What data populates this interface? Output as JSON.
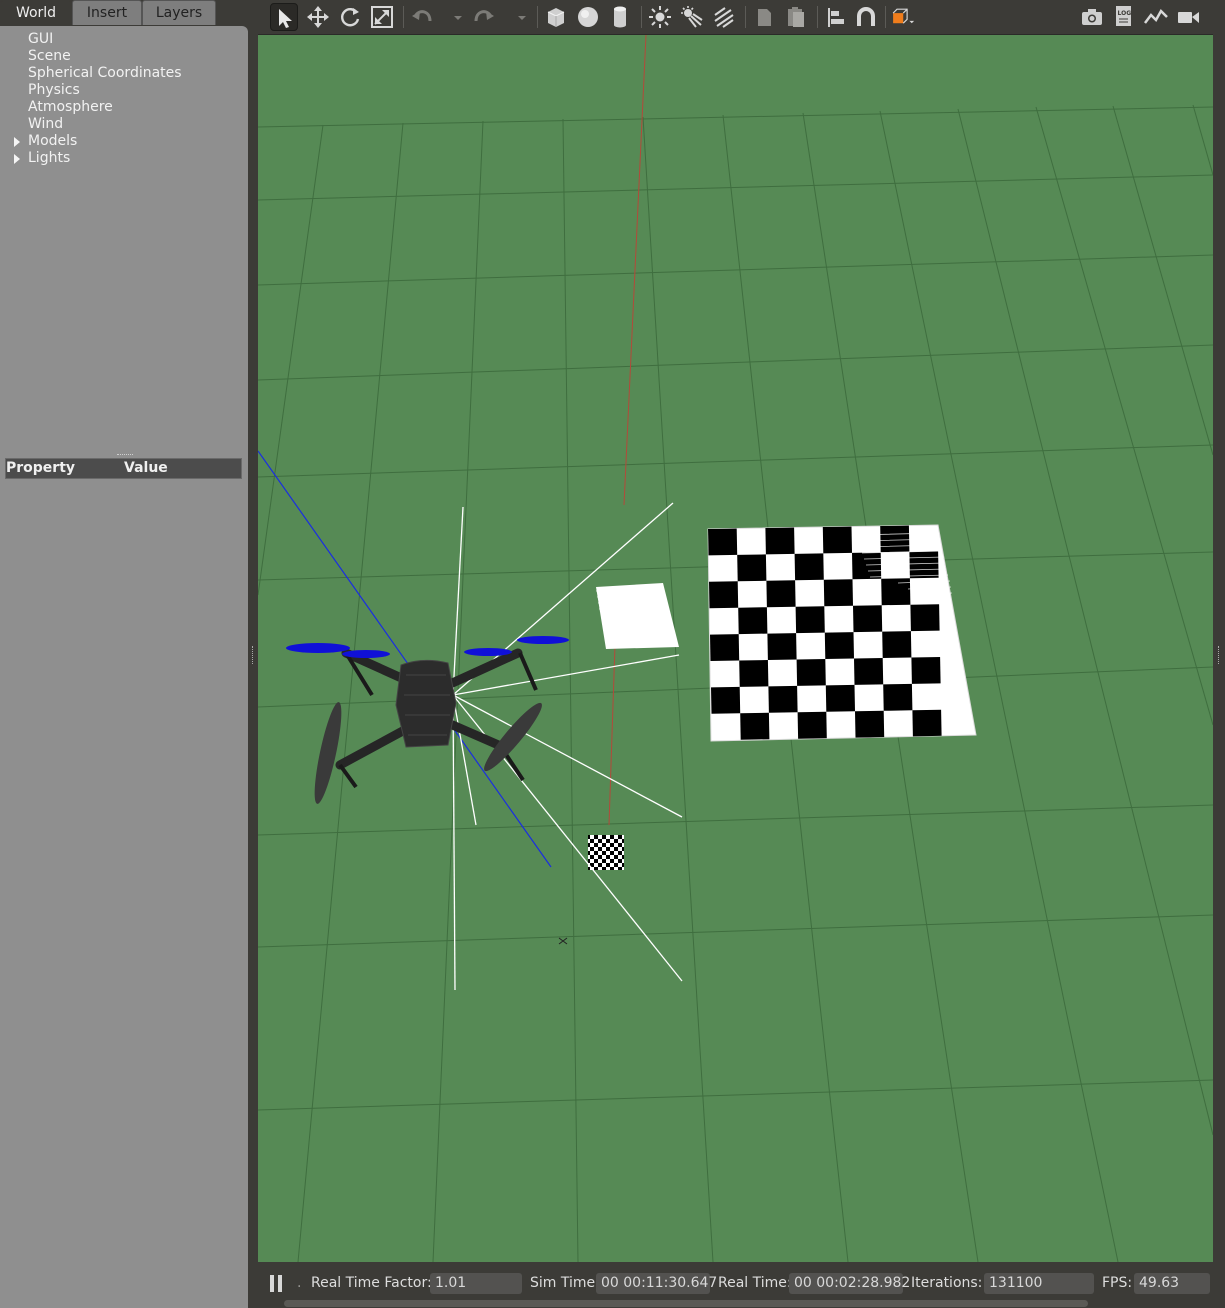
{
  "left_tabs": [
    {
      "label": "World",
      "active": true
    },
    {
      "label": "Insert",
      "active": false
    },
    {
      "label": "Layers",
      "active": false
    }
  ],
  "world_tree": [
    {
      "label": "GUI",
      "expandable": false
    },
    {
      "label": "Scene",
      "expandable": false
    },
    {
      "label": "Spherical Coordinates",
      "expandable": false
    },
    {
      "label": "Physics",
      "expandable": false
    },
    {
      "label": "Atmosphere",
      "expandable": false
    },
    {
      "label": "Wind",
      "expandable": false
    },
    {
      "label": "Models",
      "expandable": true
    },
    {
      "label": "Lights",
      "expandable": true
    }
  ],
  "property_table": {
    "col_property": "Property",
    "col_value": "Value"
  },
  "toolbar_icons": [
    "select-mode-icon",
    "translate-mode-icon",
    "rotate-mode-icon",
    "scale-mode-icon",
    "undo-icon",
    "undo-history-icon",
    "redo-icon",
    "redo-history-icon",
    "box-shape-icon",
    "sphere-shape-icon",
    "cylinder-shape-icon",
    "point-light-icon",
    "spot-light-icon",
    "directional-light-icon",
    "copy-icon",
    "paste-icon",
    "align-icon",
    "snap-magnet-icon",
    "change-view-icon",
    "screenshot-camera-icon",
    "log-icon",
    "plot-icon",
    "video-record-icon"
  ],
  "colors": {
    "ground": "#568a55",
    "grid_line": "#3f6e3f",
    "panel": "#8f8f8f",
    "dark_chrome": "#3c3b37",
    "propeller_blue": "#1010d8",
    "drone_body": "#2c2c2c",
    "accent_orange": "#f07d1c"
  },
  "status": {
    "real_time_factor_label": "Real Time Factor:",
    "real_time_factor": "1.01",
    "sim_time_label": "Sim Time:",
    "sim_time": "00 00:11:30.647",
    "real_time_label": "Real Time:",
    "real_time": "00 00:02:28.982",
    "iterations_label": "Iterations:",
    "iterations": "131100",
    "fps_label": "FPS:",
    "fps": "49.63",
    "step_label": "."
  }
}
